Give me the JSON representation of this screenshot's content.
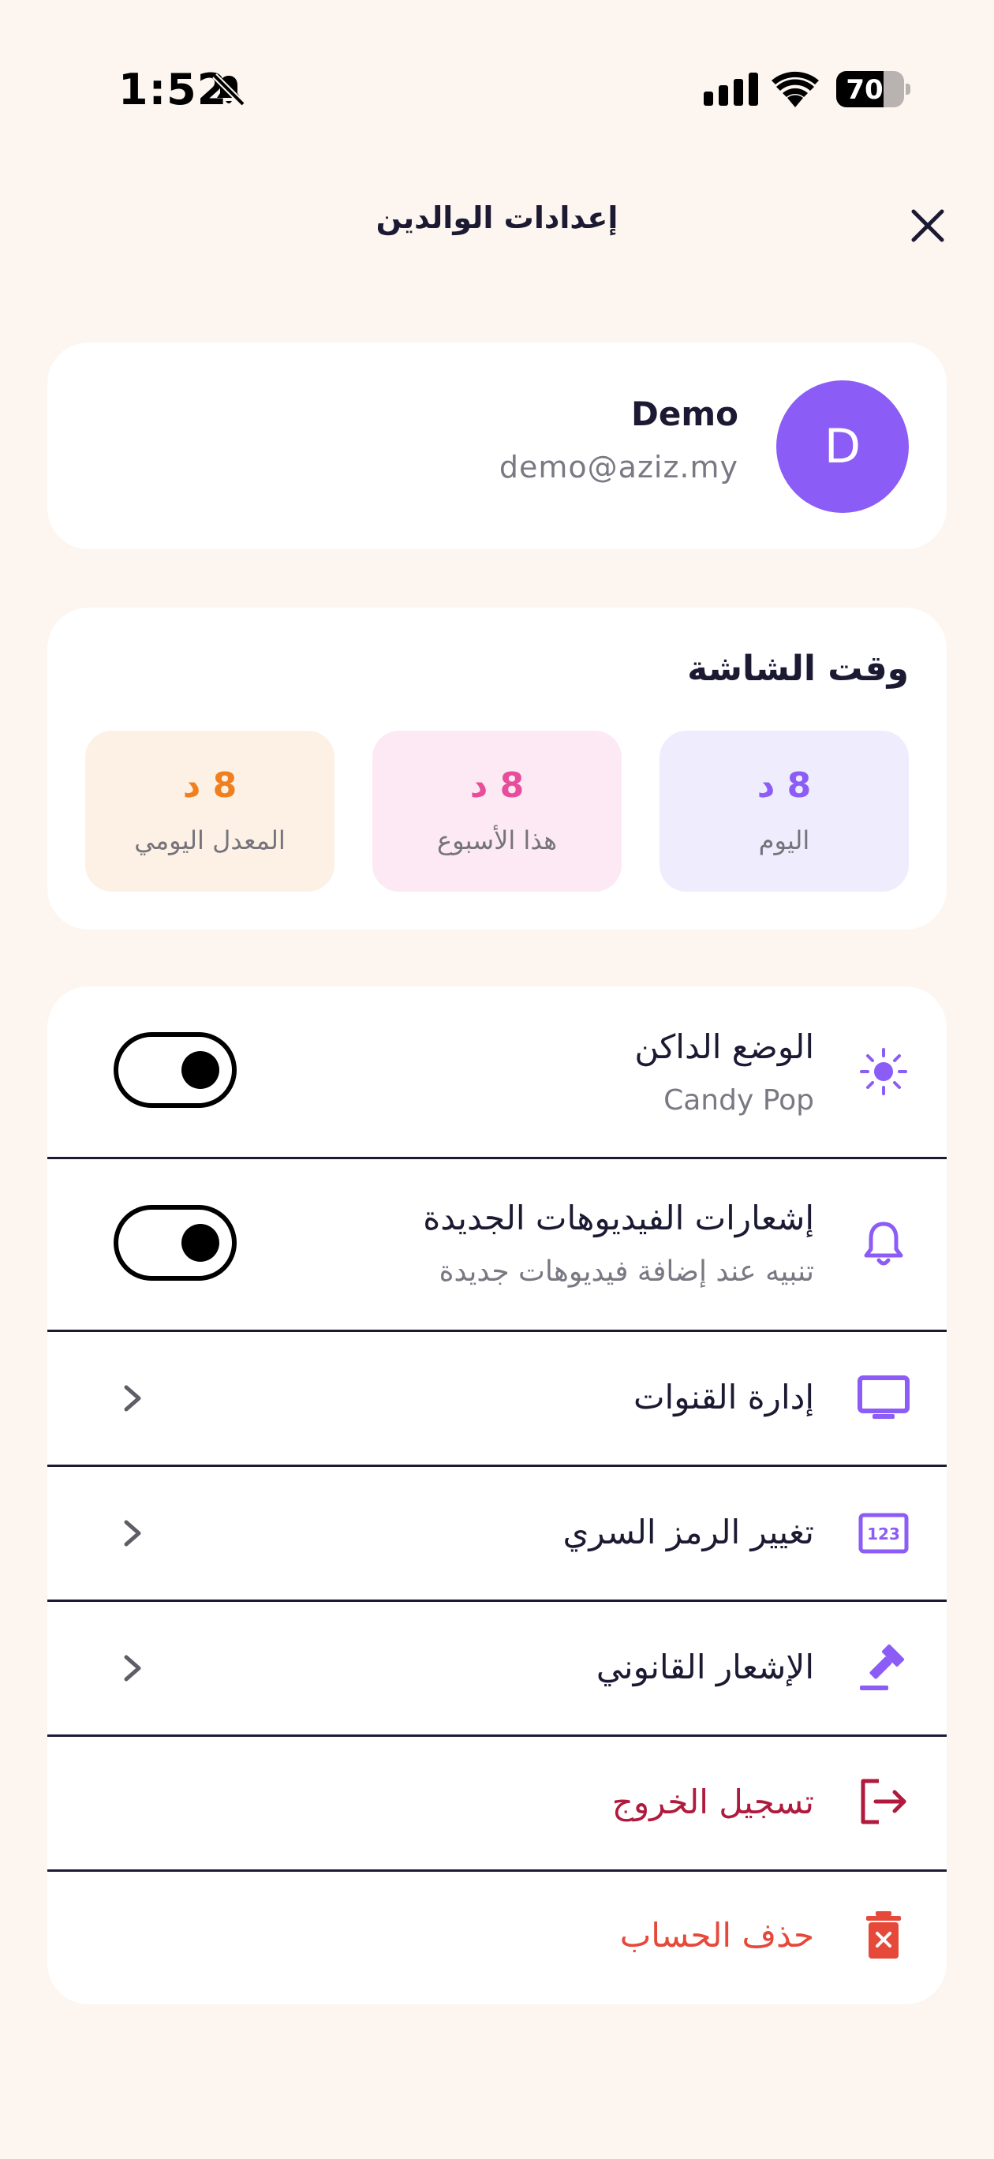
{
  "status": {
    "time": "1:52",
    "battery": "70",
    "battery_level": 0.7
  },
  "header": {
    "title": "إعدادات الوالدين"
  },
  "profile": {
    "initial": "D",
    "name": "Demo",
    "email": "demo@aziz.my"
  },
  "screen_time": {
    "title": "وقت الشاشة",
    "today": {
      "value": "8 د",
      "label": "اليوم"
    },
    "week": {
      "value": "8 د",
      "label": "هذا الأسبوع"
    },
    "daily_avg": {
      "value": "8 د",
      "label": "المعدل اليومي"
    }
  },
  "settings": {
    "dark_mode": {
      "title": "الوضع الداكن",
      "subtitle": "Candy Pop",
      "icon": "sun-icon",
      "toggle_on": true
    },
    "notifications": {
      "title": "إشعارات الفيديوهات الجديدة",
      "subtitle": "تنبيه عند إضافة فيديوهات جديدة",
      "icon": "bell-icon",
      "toggle_on": true
    },
    "channels": {
      "title": "إدارة القنوات",
      "icon": "tv-icon"
    },
    "pin": {
      "title": "تغيير الرمز السري",
      "icon": "pin-123-icon"
    },
    "legal": {
      "title": "الإشعار القانوني",
      "icon": "gavel-icon"
    },
    "logout": {
      "title": "تسجيل الخروج",
      "icon": "logout-icon",
      "color": "#b01a3c"
    },
    "delete": {
      "title": "حذف الحساب",
      "icon": "trash-icon",
      "color": "#e6483a"
    }
  },
  "colors": {
    "accent": "#8b5cf6",
    "background": "#fdf5ef",
    "today_bg": "#efedfd",
    "week_bg": "#fce9f3",
    "avg_bg": "#fdf0e4"
  }
}
